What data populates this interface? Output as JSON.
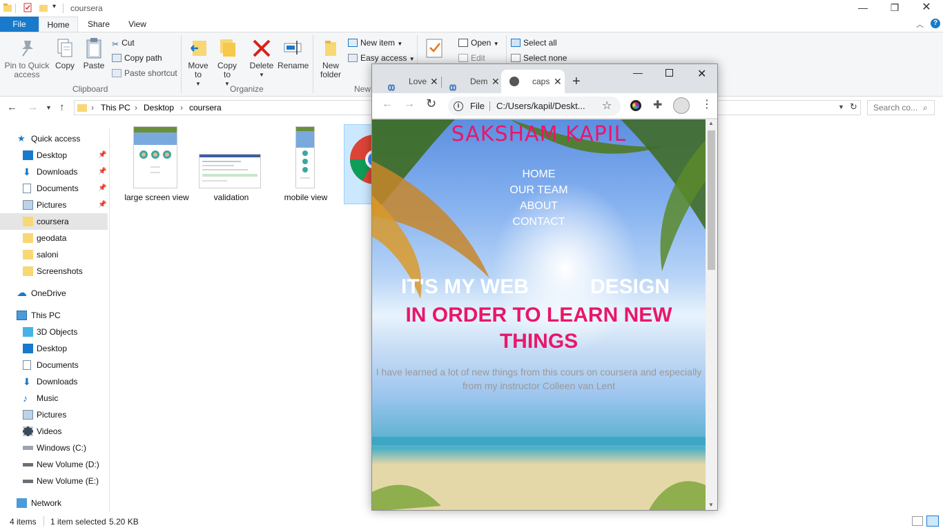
{
  "explorer": {
    "window_title": "coursera",
    "tabs": {
      "file": "File",
      "home": "Home",
      "share": "Share",
      "view": "View"
    },
    "ribbon": {
      "pin_label": "Pin to Quick access",
      "copy_label": "Copy",
      "paste_label": "Paste",
      "cut_label": "Cut",
      "copy_path_label": "Copy path",
      "paste_shortcut_label": "Paste shortcut",
      "clipboard_group": "Clipboard",
      "move_to_label": "Move to",
      "copy_to_label": "Copy to",
      "delete_label": "Delete",
      "rename_label": "Rename",
      "organize_group": "Organize",
      "new_folder_label": "New folder",
      "new_item_label": "New item",
      "easy_access_label": "Easy access",
      "new_group": "New",
      "open_label": "Open",
      "edit_label": "Edit",
      "select_all_label": "Select all",
      "select_none_label": "Select none"
    },
    "breadcrumb": [
      "This PC",
      "Desktop",
      "coursera"
    ],
    "search_placeholder": "Search co...",
    "nav": {
      "quick_access": "Quick access",
      "qa_items": [
        "Desktop",
        "Downloads",
        "Documents",
        "Pictures",
        "coursera",
        "geodata",
        "saloni",
        "Screenshots"
      ],
      "onedrive": "OneDrive",
      "this_pc": "This PC",
      "pc_items": [
        "3D Objects",
        "Desktop",
        "Documents",
        "Downloads",
        "Music",
        "Pictures",
        "Videos",
        "Windows (C:)",
        "New Volume (D:)",
        "New Volume (E:)"
      ],
      "network": "Network"
    },
    "files": [
      "large screen view",
      "validation",
      "mobile view"
    ],
    "status": {
      "count": "4 items",
      "selected": "1 item selected",
      "size": "5.20 KB"
    }
  },
  "chrome": {
    "tabs": [
      "Love",
      "Dem",
      "caps"
    ],
    "omnibox_scheme": "File",
    "omnibox_url": "C:/Users/kapil/Deskt...",
    "page": {
      "name": "SAKSHAM KAPIL",
      "nav": [
        "HOME",
        "OUR TEAM",
        "ABOUT",
        "CONTACT"
      ],
      "headline_white": "IT'S MY WEB",
      "headline_white_tail": "DESIGN",
      "headline_pink": "IN ORDER TO LEARN NEW THINGS",
      "paragraph": "I have learned a lot of new things from this cours on coursera and especially from my instructor Colleen van Lent"
    }
  },
  "colors": {
    "accent": "#1979ca",
    "pink": "#e8176a",
    "folder": "#f8d775"
  }
}
